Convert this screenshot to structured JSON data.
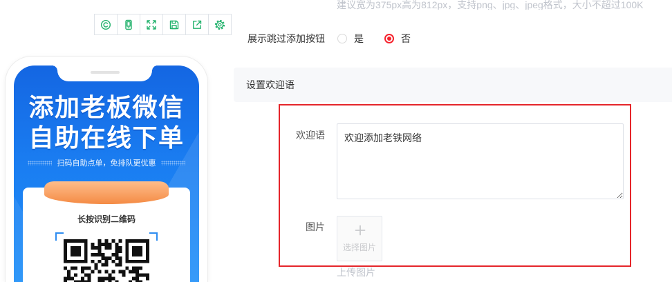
{
  "upload_hint": {
    "text": "建议宽为375px高为812px，支持png、jpg、jpeg格式，大小不超过100K"
  },
  "toolbar": {
    "icons": [
      "reset-icon",
      "mobile-preview-icon",
      "fullscreen-icon",
      "save-icon",
      "share-icon",
      "gear-icon"
    ]
  },
  "skip_button": {
    "label": "展示跳过添加按钮",
    "options": [
      {
        "label": "是",
        "checked": false
      },
      {
        "label": "否",
        "checked": true
      }
    ]
  },
  "preview": {
    "headline_line1": "添加老板微信",
    "headline_line2": "自助在线下单",
    "subline": "扫码自助点单，免排队更优惠",
    "card_title": "长按识别二维码"
  },
  "welcome_section": {
    "title": "设置欢迎语"
  },
  "welcome_form": {
    "message_label": "欢迎语",
    "message_value": "欢迎添加老铁网络",
    "image_label": "图片",
    "image_picker_label": "选择图片",
    "upload_caption": "上传图片"
  },
  "colors": {
    "accent_red": "#f5222d",
    "highlight_border": "#e5252a",
    "toolbar_icon": "#23b26d",
    "poster_blue": "#1a7df1",
    "poster_orange": "#f48b45"
  }
}
